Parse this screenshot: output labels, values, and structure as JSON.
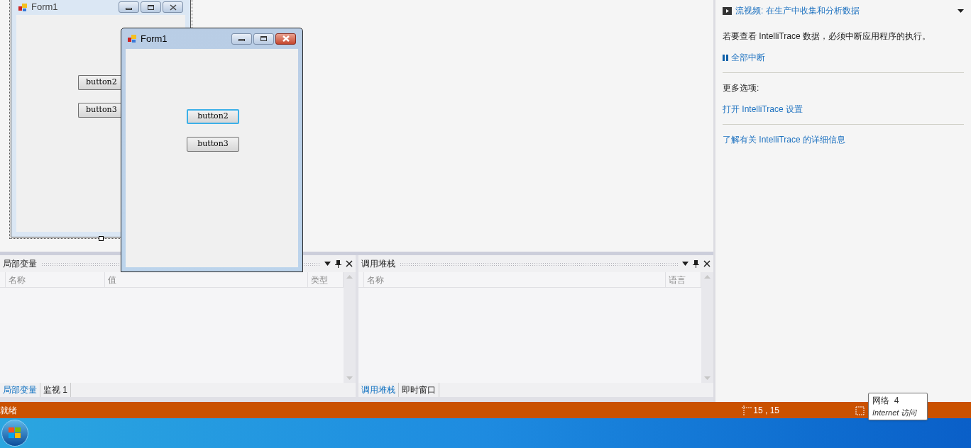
{
  "designer_form": {
    "title": "Form1",
    "buttons": [
      "button2",
      "button3"
    ]
  },
  "running_form": {
    "title": "Form1",
    "buttons": [
      {
        "label": "button2",
        "focused": true
      },
      {
        "label": "button3",
        "focused": false
      }
    ]
  },
  "locals_panel": {
    "title": "局部变量",
    "columns": [
      "名称",
      "值",
      "类型"
    ],
    "tabs": [
      {
        "label": "局部变量",
        "selected": true
      },
      {
        "label": "监视 1",
        "selected": false
      }
    ]
  },
  "callstack_panel": {
    "title": "调用堆栈",
    "columns": [
      "名称",
      "语言"
    ],
    "tabs": [
      {
        "label": "调用堆栈",
        "selected": true
      },
      {
        "label": "即时窗口",
        "selected": false
      }
    ]
  },
  "intellitrace": {
    "video_link": "流视频: 在生产中收集和分析数据",
    "message": "若要查看 IntelliTrace 数据，必须中断应用程序的执行。",
    "break_all": "全部中断",
    "more_options": "更多选项:",
    "settings_link": "打开 IntelliTrace 设置",
    "learn_link": "了解有关 IntelliTrace 的详细信息"
  },
  "status_bar": {
    "text": "就绪",
    "position": "15 , 15"
  },
  "tooltip": {
    "title": "网络  4",
    "subtitle": "Internet 访问"
  }
}
